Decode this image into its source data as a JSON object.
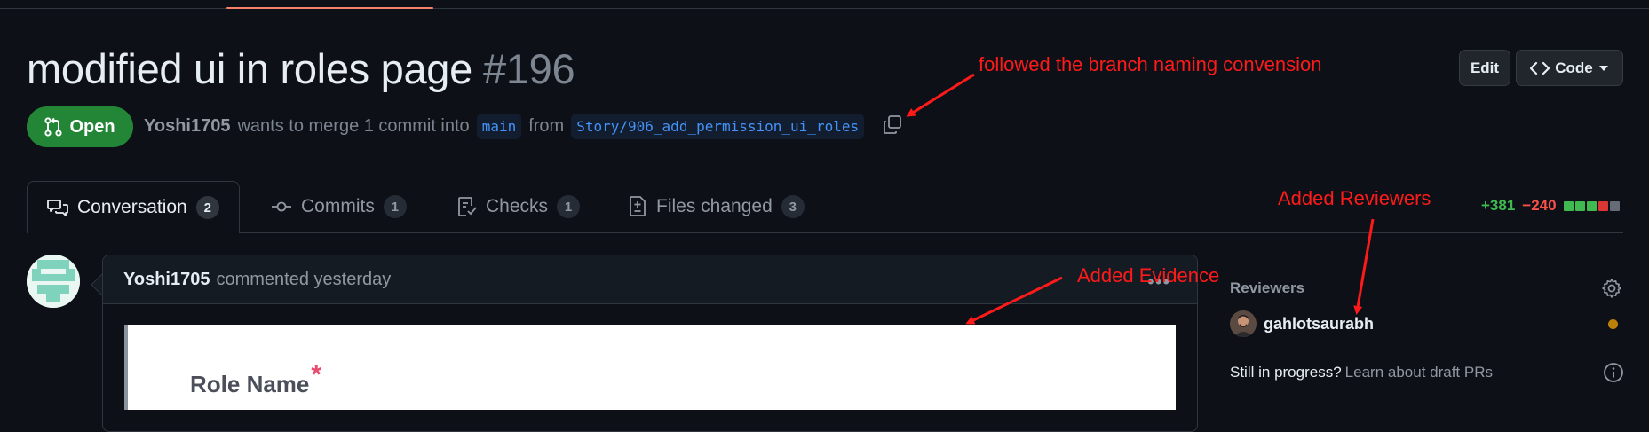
{
  "pr": {
    "title": "modified ui in roles page",
    "number": "#196",
    "state": "Open",
    "author": "Yoshi1705",
    "merge_text": "wants to merge 1 commit into",
    "base_branch": "main",
    "from_text": "from",
    "head_branch": "Story/906_add_permission_ui_roles"
  },
  "header_buttons": {
    "edit": "Edit",
    "code": "Code"
  },
  "tabs": [
    {
      "label": "Conversation",
      "count": "2",
      "icon": "comment-discussion-icon"
    },
    {
      "label": "Commits",
      "count": "1",
      "icon": "git-commit-icon"
    },
    {
      "label": "Checks",
      "count": "1",
      "icon": "checklist-icon"
    },
    {
      "label": "Files changed",
      "count": "3",
      "icon": "file-diff-icon"
    }
  ],
  "diffstat": {
    "additions": "+381",
    "deletions": "−240",
    "blocks": [
      "#3fb950",
      "#3fb950",
      "#3fb950",
      "#da3633",
      "#656c76"
    ]
  },
  "comment": {
    "author": "Yoshi1705",
    "action": "commented yesterday",
    "evidence_label": "Role Name",
    "required_mark": "*"
  },
  "sidebar": {
    "reviewers_heading": "Reviewers",
    "reviewer_name": "gahlotsaurabh",
    "draft_text": "Still in progress?",
    "draft_link": "Learn about draft PRs"
  },
  "annotations": {
    "branch_note": "followed the branch naming convension",
    "reviewers_note": "Added Reviewers",
    "evidence_note": "Added Evidence"
  },
  "colors": {
    "background": "#0d1117",
    "open_green": "#238636",
    "link_blue": "#4493f8",
    "annotation_red": "#ff1a1a",
    "pending_orange": "#bb8009"
  }
}
